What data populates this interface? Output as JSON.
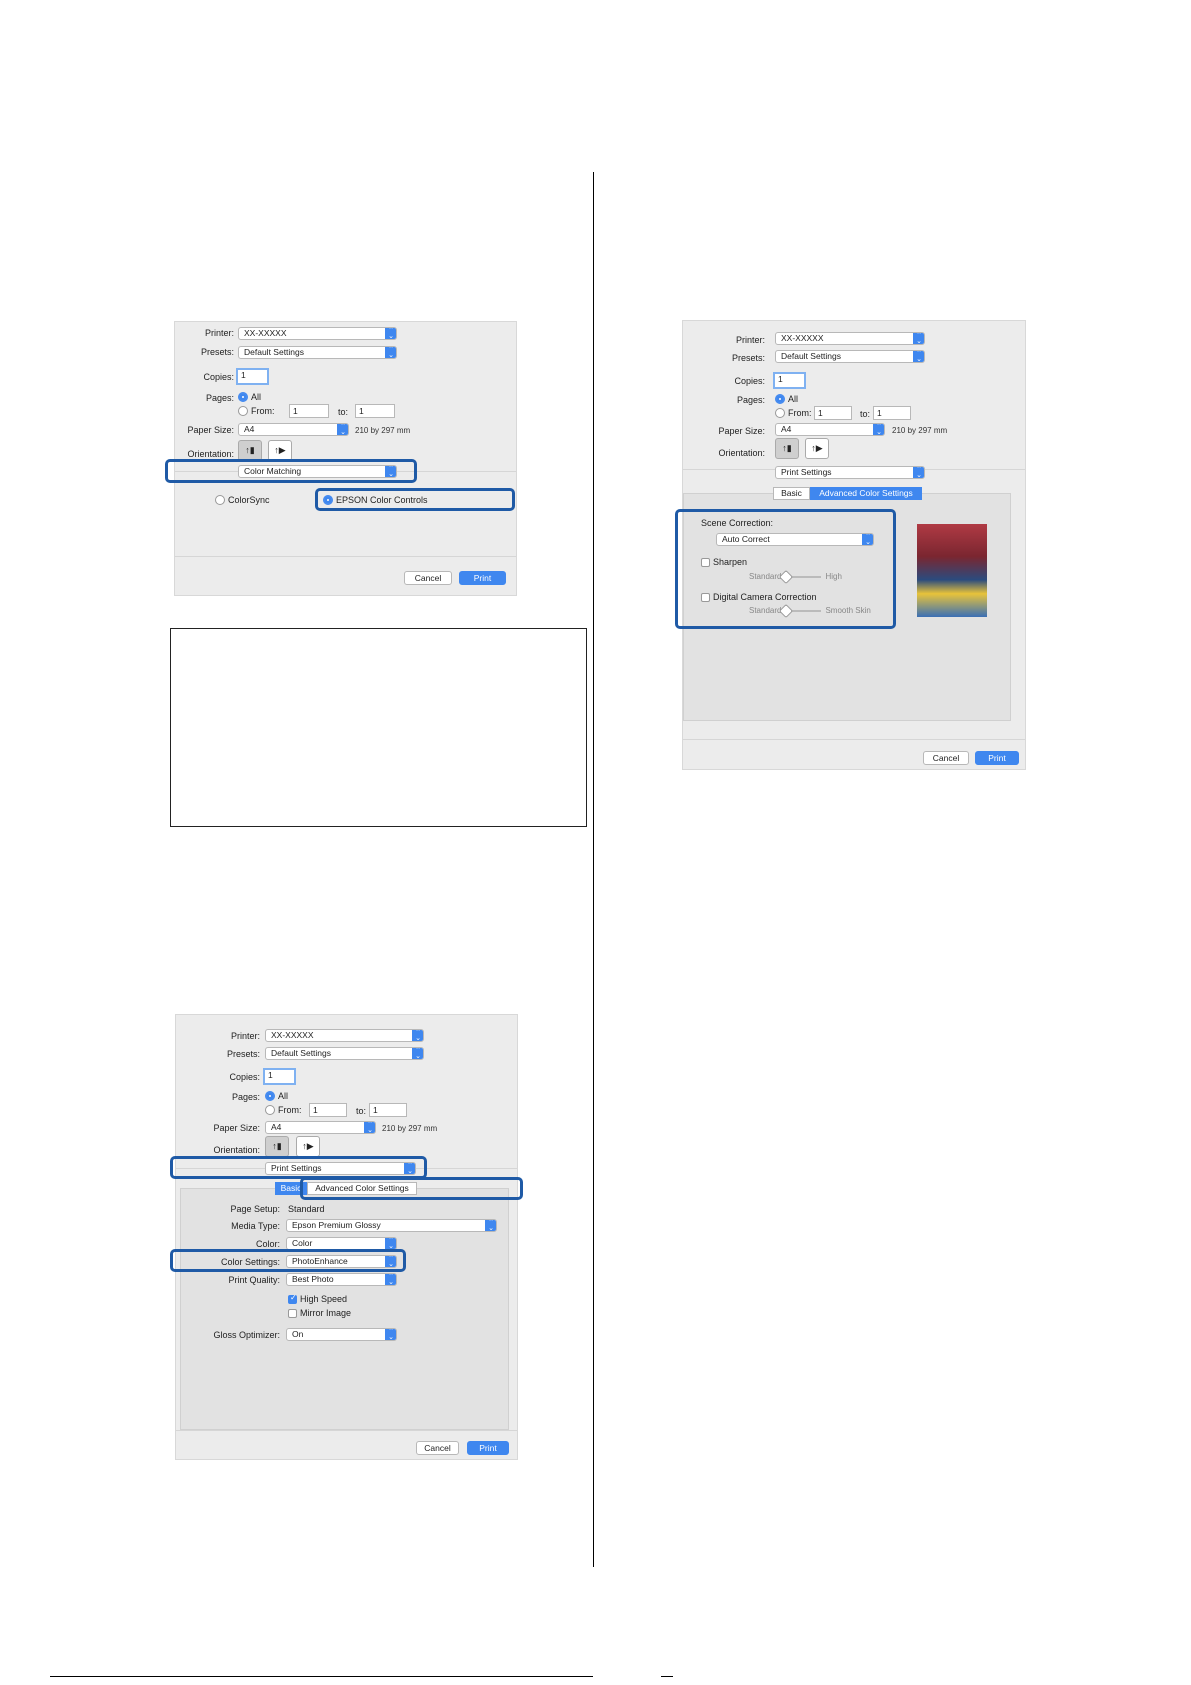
{
  "dialog_common": {
    "printer_label": "Printer:",
    "printer_value": "XX-XXXXX",
    "presets_label": "Presets:",
    "presets_value": "Default Settings",
    "copies_label": "Copies:",
    "copies_value": "1",
    "pages_label": "Pages:",
    "pages_all": "All",
    "pages_from": "From:",
    "pages_from_value": "1",
    "pages_to": "to:",
    "pages_to_value": "1",
    "paper_size_label": "Paper Size:",
    "paper_size_value": "A4",
    "paper_size_dims": "210 by 297 mm",
    "orientation_label": "Orientation:",
    "cancel_label": "Cancel",
    "print_label": "Print"
  },
  "dialog1": {
    "panel_popup": "Color Matching",
    "colorsync": "ColorSync",
    "epson_controls": "EPSON Color Controls"
  },
  "dialog2": {
    "panel_popup": "Print Settings",
    "tab_basic": "Basic",
    "tab_advanced": "Advanced Color Settings",
    "page_setup_label": "Page Setup:",
    "page_setup_value": "Standard",
    "media_type_label": "Media Type:",
    "media_type_value": "Epson Premium Glossy",
    "color_label": "Color:",
    "color_value": "Color",
    "color_settings_label": "Color Settings:",
    "color_settings_value": "PhotoEnhance",
    "print_quality_label": "Print Quality:",
    "print_quality_value": "Best Photo",
    "high_speed": "High Speed",
    "mirror_image": "Mirror Image",
    "gloss_label": "Gloss Optimizer:",
    "gloss_value": "On"
  },
  "dialog3": {
    "panel_popup": "Print Settings",
    "tab_basic": "Basic",
    "tab_advanced": "Advanced Color Settings",
    "scene_label": "Scene Correction:",
    "scene_value": "Auto Correct",
    "sharpen": "Sharpen",
    "sharpen_low": "Standard",
    "sharpen_high": "High",
    "digital_camera": "Digital Camera Correction",
    "dcc_low": "Standard",
    "dcc_high": "Smooth Skin"
  },
  "colors": {
    "accent": "#3f87ef",
    "highlight": "#1f5aa6",
    "dialog_bg": "#ececec"
  }
}
